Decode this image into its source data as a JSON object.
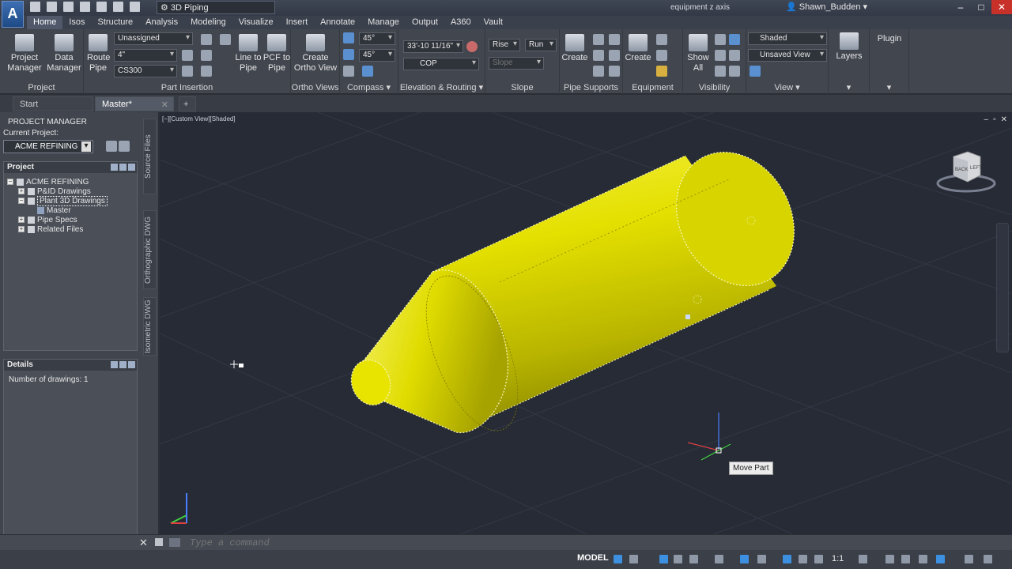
{
  "app": {
    "logo_text": "A",
    "workspace": "3D Piping",
    "doc_title": "equipment z axis",
    "user": "Shawn_Budden"
  },
  "menu": [
    "Home",
    "Isos",
    "Structure",
    "Analysis",
    "Modeling",
    "Visualize",
    "Insert",
    "Annotate",
    "Manage",
    "Output",
    "A360",
    "Vault"
  ],
  "ribbon": {
    "project": {
      "btn1": "Project\nManager",
      "btn2": "Data\nManager",
      "label": "Project"
    },
    "part_insertion": {
      "line_dropdown": "Unassigned",
      "size_dropdown": "4\"",
      "spec_dropdown": "CS300",
      "route_pipe": "Route\nPipe",
      "line_to_pipe": "Line to\nPipe",
      "pcf_to_pipe": "PCF to\nPipe",
      "label": "Part Insertion"
    },
    "ortho": {
      "btn": "Create\nOrtho View",
      "label": "Ortho Views"
    },
    "compass": {
      "angle1": "45°",
      "angle2": "45°",
      "label": "Compass"
    },
    "elevation": {
      "elevation_value": "33'-10 11/16\"",
      "cop": "COP",
      "label": "Elevation & Routing"
    },
    "slope": {
      "rise": "Rise",
      "run": "Run",
      "slope_placeholder": "Slope",
      "label": "Slope"
    },
    "pipe_supports": {
      "btn": "Create",
      "label": "Pipe Supports"
    },
    "equipment": {
      "btn": "Create",
      "label": "Equipment"
    },
    "visibility": {
      "btn": "Show\nAll",
      "label": "Visibility"
    },
    "view": {
      "visual_style": "Shaded",
      "named_view": "Unsaved View",
      "label": "View"
    },
    "layers": {
      "btn": "Layers"
    },
    "plugin": {
      "label": "Plugin"
    }
  },
  "file_tabs": [
    "Start",
    "Master*"
  ],
  "project_manager": {
    "title": "PROJECT MANAGER",
    "current_project_label": "Current Project:",
    "current_project": "ACME REFINING",
    "project_box_title": "Project",
    "tree": [
      {
        "label": "ACME REFINING",
        "level": 0
      },
      {
        "label": "P&ID Drawings",
        "level": 1
      },
      {
        "label": "Plant 3D Drawings",
        "level": 1
      },
      {
        "label": "Master",
        "level": 2
      },
      {
        "label": "Pipe Specs",
        "level": 1
      },
      {
        "label": "Related Files",
        "level": 1
      }
    ],
    "details_title": "Details",
    "details_text": "Number of drawings: 1"
  },
  "side_tabs": [
    "Source Files",
    "Orthographic DWG",
    "Isometric DWG"
  ],
  "viewport": {
    "label": "[−][Custom View][Shaded]",
    "tooltip": "Move Part",
    "viewcube_back": "BACK",
    "viewcube_left": "LEFT"
  },
  "command": {
    "placeholder": "Type a command"
  },
  "status": {
    "model": "MODEL",
    "scale": "1:1"
  },
  "colors": {
    "equipment": "#e0dc00",
    "viewport_bg": "#262b36"
  }
}
